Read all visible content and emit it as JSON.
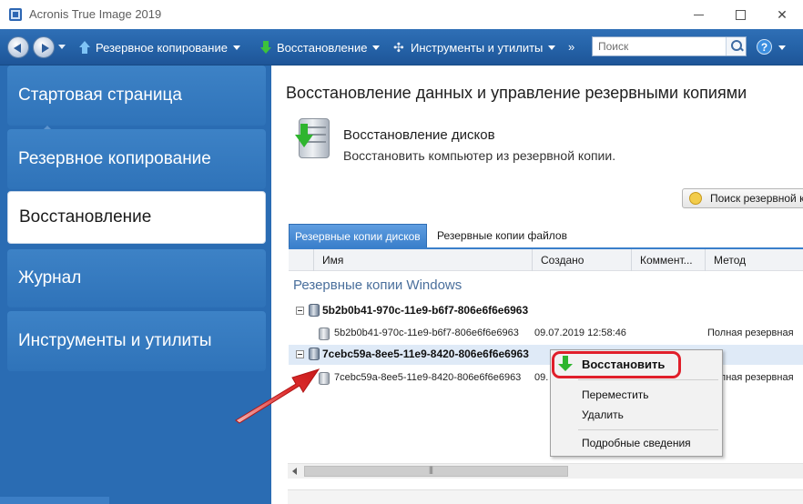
{
  "window": {
    "title": "Acronis True Image 2019"
  },
  "toolbar": {
    "backup_label": "Резервное копирование",
    "restore_label": "Восстановление",
    "tools_label": "Инструменты и утилиты",
    "more_label": "»",
    "search_placeholder": "Поиск"
  },
  "sidebar": {
    "items": [
      {
        "label": "Стартовая страница"
      },
      {
        "label": "Резервное копирование"
      },
      {
        "label": "Восстановление",
        "selected": true
      },
      {
        "label": "Журнал"
      },
      {
        "label": "Инструменты и утилиты"
      }
    ]
  },
  "main": {
    "title": "Восстановление данных и управление резервными копиями",
    "section_title": "Восстановление дисков",
    "section_desc": "Восстановить компьютер из резервной копии.",
    "search_backup_label": "Поиск резервной к",
    "tabs": [
      {
        "label": "Резервные копии дисков",
        "active": true
      },
      {
        "label": "Резервные копии файлов",
        "active": false
      }
    ],
    "columns": [
      "Имя",
      "Создано",
      "Коммент...",
      "Метод"
    ],
    "group_title": "Резервные копии Windows",
    "rows": [
      {
        "name": "5b2b0b41-970c-11e9-b6f7-806e6f6e6963",
        "type": "group"
      },
      {
        "name": "5b2b0b41-970c-11e9-b6f7-806e6f6e6963",
        "created": "09.07.2019 12:58:46",
        "method": "Полная резервная"
      },
      {
        "name": "7cebc59a-8ee5-11e9-8420-806e6f6e6963",
        "type": "group",
        "selected": true
      },
      {
        "name": "7cebc59a-8ee5-11e9-8420-806e6f6e6963",
        "created": "09.",
        "method": "Полная резервная"
      }
    ]
  },
  "context_menu": {
    "items": [
      {
        "label": "Восстановить",
        "bold": true
      },
      {
        "label": "Переместить"
      },
      {
        "label": "Удалить"
      },
      {
        "label": "Подробные сведения"
      }
    ]
  },
  "colors": {
    "toolbar_blue": "#2563a8",
    "sidebar_blue": "#2a6cb3",
    "highlight_red": "#e01f2a",
    "restore_green": "#2fb52f"
  }
}
